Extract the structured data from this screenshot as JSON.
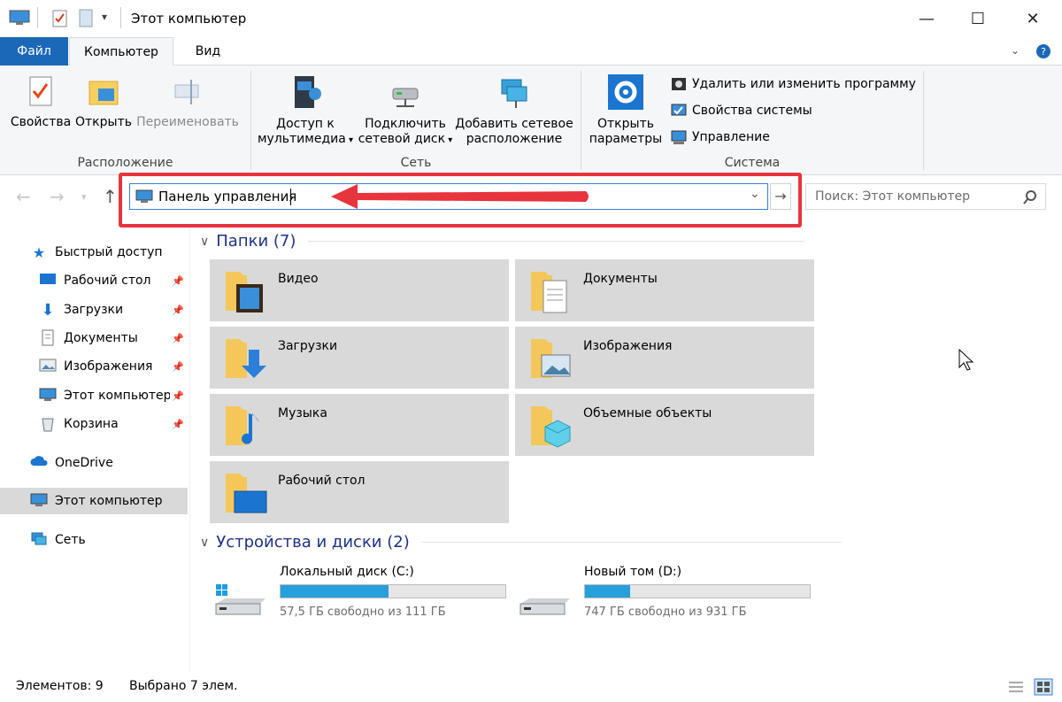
{
  "window": {
    "title": "Этот компьютер",
    "minimize": "—",
    "maximize": "☐",
    "close": "✕"
  },
  "tabs": {
    "file": "Файл",
    "computer": "Компьютер",
    "view": "Вид"
  },
  "ribbon": {
    "location": {
      "label": "Расположение",
      "properties": "Свойства",
      "open": "Открыть",
      "rename": "Переименовать"
    },
    "network": {
      "label": "Сеть",
      "media_line1": "Доступ к",
      "media_line2": "мультимедиа",
      "map_line1": "Подключить",
      "map_line2": "сетевой диск",
      "add_line1": "Добавить сетевое",
      "add_line2": "расположение"
    },
    "system": {
      "label": "Система",
      "open_line1": "Открыть",
      "open_line2": "параметры",
      "uninstall": "Удалить или изменить программу",
      "sys_props": "Свойства системы",
      "manage": "Управление"
    }
  },
  "address": {
    "value": "Панель управления"
  },
  "search": {
    "placeholder": "Поиск: Этот компьютер"
  },
  "sidebar": {
    "quick_access": "Быстрый доступ",
    "items": [
      {
        "label": "Рабочий стол"
      },
      {
        "label": "Загрузки"
      },
      {
        "label": "Документы"
      },
      {
        "label": "Изображения"
      },
      {
        "label": "Этот компьютер"
      },
      {
        "label": "Корзина"
      }
    ],
    "onedrive": "OneDrive",
    "this_pc": "Этот компьютер",
    "network": "Сеть"
  },
  "folders": {
    "header": "Папки (7)",
    "items": [
      "Видео",
      "Документы",
      "Загрузки",
      "Изображения",
      "Музыка",
      "Объемные объекты",
      "Рабочий стол"
    ]
  },
  "drives": {
    "header": "Устройства и диски (2)",
    "items": [
      {
        "name": "Локальный диск (C:)",
        "status": "57,5 ГБ свободно из 111 ГБ",
        "used_fraction": 0.48
      },
      {
        "name": "Новый том (D:)",
        "status": "747 ГБ свободно из 931 ГБ",
        "used_fraction": 0.2
      }
    ]
  },
  "statusbar": {
    "count": "Элементов: 9",
    "selected": "Выбрано 7 элем."
  },
  "colors": {
    "accent": "#1b68b9",
    "highlight_box": "#e8343c",
    "drive_fill": "#26a0da"
  }
}
